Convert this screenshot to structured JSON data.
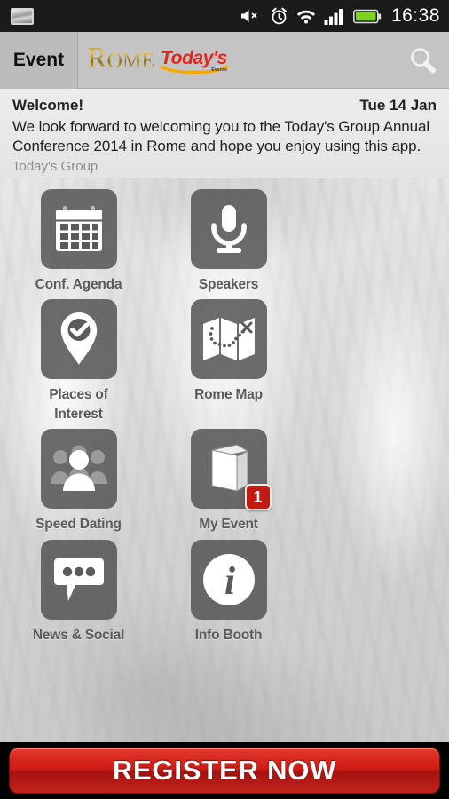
{
  "status_bar": {
    "left_icon": "screenshot-icon",
    "icons": [
      "volume-mute-icon",
      "alarm-clock-icon",
      "wifi-icon",
      "signal-bars-icon",
      "battery-icon"
    ],
    "time": "16:38",
    "battery_color": "#7ed321"
  },
  "header": {
    "event_label": "Event",
    "logo_primary": "Rome",
    "logo_secondary": "Today's",
    "logo_tagline": "Events",
    "search_icon": "search-icon",
    "background_color": "#c4c4c4",
    "logo_gold": "#c9a227",
    "logo_red": "#e2231a"
  },
  "welcome": {
    "title": "Welcome!",
    "date": "Tue 14 Jan",
    "body": "We look forward to welcoming you to the Today's Group Annual Conference 2014 in Rome and hope you enjoy using this app.",
    "source": "Today's Group"
  },
  "grid": {
    "tiles": [
      {
        "label": "Conf. Agenda",
        "icon": "calendar-icon",
        "badge": null
      },
      {
        "label": "Speakers",
        "icon": "microphone-icon",
        "badge": null
      },
      {
        "label": "Places of\nInterest",
        "icon": "map-pin-check-icon",
        "badge": null
      },
      {
        "label": "Rome Map",
        "icon": "folded-map-icon",
        "badge": null
      },
      {
        "label": "Speed Dating",
        "icon": "people-group-icon",
        "badge": null
      },
      {
        "label": "My Event",
        "icon": "book-icon",
        "badge": "1"
      },
      {
        "label": "News & Social",
        "icon": "speech-bubble-icon",
        "badge": null
      },
      {
        "label": "Info Booth",
        "icon": "info-circle-icon",
        "badge": null
      }
    ],
    "tile_color": "#555555",
    "label_color": "#5b5b5b",
    "badge_color": "#c01a13"
  },
  "bottom_bar": {
    "register_label": "REGISTER NOW",
    "button_color": "#cf1b16"
  }
}
